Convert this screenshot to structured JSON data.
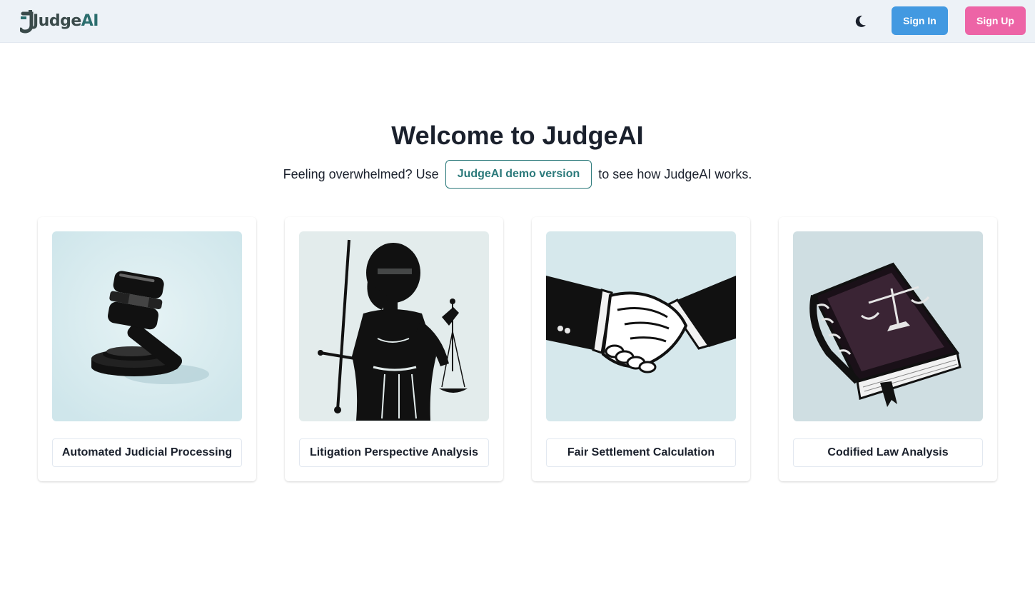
{
  "header": {
    "logo": {
      "text_prefix": "Judge",
      "text_suffix": "AI"
    },
    "theme_toggle_icon": "moon-icon",
    "sign_in_label": "Sign In",
    "sign_up_label": "Sign Up",
    "colors": {
      "background": "#edf2f7",
      "sign_in": "#4299e1",
      "sign_up": "#ed64a6"
    }
  },
  "hero": {
    "title": "Welcome to JudgeAI",
    "prefix": "Feeling overwhelmed? Use",
    "demo_button": "JudgeAI demo version",
    "suffix": "to see how JudgeAI works.",
    "accent_color": "#2c7a7b"
  },
  "cards": [
    {
      "label": "Automated Judicial Processing",
      "image": "gavel-illustration"
    },
    {
      "label": "Litigation Perspective Analysis",
      "image": "lady-justice-illustration"
    },
    {
      "label": "Fair Settlement Calculation",
      "image": "handshake-illustration"
    },
    {
      "label": "Codified Law Analysis",
      "image": "law-book-illustration"
    }
  ]
}
